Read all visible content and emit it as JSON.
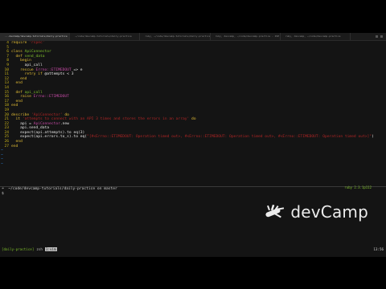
{
  "tabs": [
    {
      "label": "...devCamp/devcamp-tutorials/daily-practice",
      "active": true
    },
    {
      "label": "~/code/devcamp-tutorials/daily-practice",
      "active": false
    },
    {
      "label": "ruby, ~/code/devcamp-tutorials/daily-practice",
      "active": false
    },
    {
      "label": "ruby, devcamp, ~/code/devcamp-practice - ZSH ~ 80",
      "active": false
    },
    {
      "label": "ruby, devcamp, ~/code/devcamp-practice",
      "active": false
    }
  ],
  "editor": {
    "lines": [
      {
        "n": "4",
        "segs": [
          {
            "t": "require ",
            "c": "kw"
          },
          {
            "t": "'rspec'",
            "c": "str"
          }
        ]
      },
      {
        "n": "5",
        "segs": []
      },
      {
        "n": "6",
        "segs": [
          {
            "t": "class ",
            "c": "kw"
          },
          {
            "t": "ApiConnector",
            "c": "grn"
          }
        ]
      },
      {
        "n": "7",
        "segs": [
          {
            "t": "  def ",
            "c": "kw"
          },
          {
            "t": "send_data",
            "c": "grn"
          }
        ]
      },
      {
        "n": "8",
        "segs": [
          {
            "t": "    begin",
            "c": "kw"
          }
        ]
      },
      {
        "n": "9",
        "segs": [
          {
            "t": "      api_call",
            "c": "code"
          }
        ]
      },
      {
        "n": "10",
        "segs": [
          {
            "t": "    rescue ",
            "c": "kw"
          },
          {
            "t": "Errno::ETIMEDOUT",
            "c": "const"
          },
          {
            "t": " => e",
            "c": "code"
          }
        ]
      },
      {
        "n": "11",
        "segs": [
          {
            "t": "      retry if ",
            "c": "kw"
          },
          {
            "t": "@attempts",
            "c": "code"
          },
          {
            "t": " < 3",
            "c": "code"
          }
        ]
      },
      {
        "n": "12",
        "segs": [
          {
            "t": "    end",
            "c": "kw"
          }
        ]
      },
      {
        "n": "13",
        "segs": [
          {
            "t": "  end",
            "c": "kw"
          }
        ]
      },
      {
        "n": "14",
        "segs": []
      },
      {
        "n": "15",
        "segs": [
          {
            "t": "  def ",
            "c": "kw"
          },
          {
            "t": "api_call",
            "c": "grn"
          }
        ]
      },
      {
        "n": "16",
        "segs": [
          {
            "t": "    raise ",
            "c": "kw"
          },
          {
            "t": "Errno::ETIMEDOUT",
            "c": "const"
          }
        ]
      },
      {
        "n": "17",
        "segs": [
          {
            "t": "  end",
            "c": "kw"
          }
        ]
      },
      {
        "n": "18",
        "segs": [
          {
            "t": "end",
            "c": "kw"
          }
        ]
      },
      {
        "n": "19",
        "segs": []
      },
      {
        "n": "20",
        "segs": [
          {
            "t": "describe ",
            "c": "kw"
          },
          {
            "t": "'ApiConnector'",
            "c": "str"
          },
          {
            "t": " do",
            "c": "kw"
          }
        ]
      },
      {
        "n": "21",
        "segs": [
          {
            "t": "  it ",
            "c": "kw"
          },
          {
            "t": "'attempts to connect with an API 3 times and stores the errors in an array'",
            "c": "str"
          },
          {
            "t": " do",
            "c": "kw"
          }
        ]
      },
      {
        "n": "22",
        "segs": [
          {
            "t": "    api = ",
            "c": "code"
          },
          {
            "t": "ApiConnector",
            "c": "const"
          },
          {
            "t": ".new",
            "c": "code"
          }
        ]
      },
      {
        "n": "23",
        "segs": [
          {
            "t": "    api.send_data",
            "c": "code"
          }
        ]
      },
      {
        "n": "24",
        "segs": [
          {
            "t": "    expect(api.attempts).to eq(3)",
            "c": "code"
          }
        ]
      },
      {
        "n": "25",
        "segs": [
          {
            "t": "    expect(api.errors.to_s).to eq(",
            "c": "code"
          },
          {
            "t": "\"[#<Errno::ETIMEDOUT: Operation timed out>, #<Errno::ETIMEDOUT: Operation timed out>, #<Errno::ETIMEDOUT: Operation timed out>]\"",
            "c": "str"
          },
          {
            "t": ")",
            "c": "code"
          }
        ]
      },
      {
        "n": "26",
        "segs": [
          {
            "t": "  end",
            "c": "kw"
          }
        ]
      },
      {
        "n": "27",
        "segs": [
          {
            "t": "end",
            "c": "kw"
          }
        ]
      }
    ],
    "tildes": [
      "~",
      "~",
      "~",
      "~"
    ]
  },
  "terminal": {
    "prompt": "➜  ~/code/devcamp-tutorials/daily-practice on master",
    "cursor": "$",
    "ruby_version": "ruby 2.3.1p112"
  },
  "brand": {
    "name": "devCamp",
    "logo_icon": "swiss-army-knife-icon"
  },
  "statusbar": {
    "session": "[daily-practice]",
    "windows": [
      {
        "label": "zsh",
        "active": false
      },
      {
        "label": "1:vim",
        "active": true
      }
    ],
    "clock": "13:56"
  }
}
